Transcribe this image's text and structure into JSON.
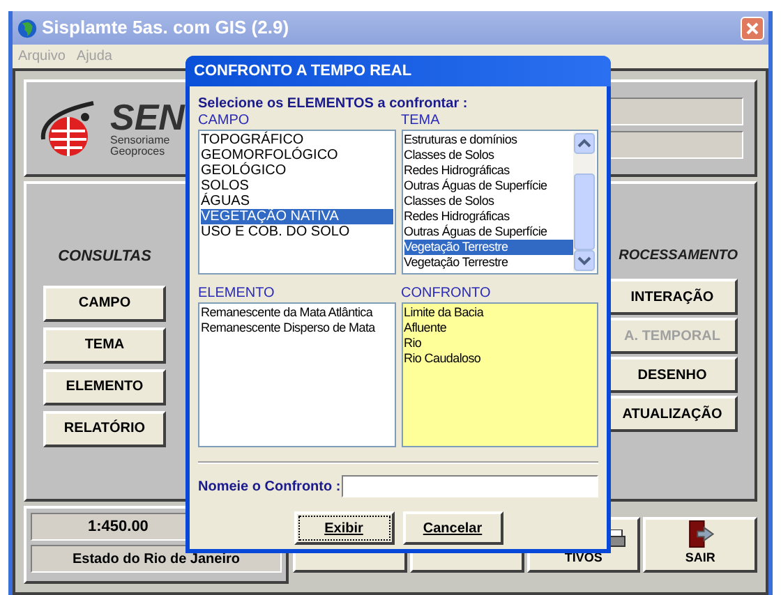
{
  "window": {
    "title": "Sisplamte 5as. com GIS (2.9)"
  },
  "menu": [
    {
      "label": "Arquivo",
      "disabled": true
    },
    {
      "label": "Ajuda",
      "disabled": true
    }
  ],
  "logo": {
    "mark": "SEN",
    "line_1": "Sensoriame",
    "line_2": "Geoproces"
  },
  "consultas": {
    "heading": "CONSULTAS",
    "buttons": [
      {
        "label": "CAMPO",
        "disabled": false
      },
      {
        "label": "TEMA",
        "disabled": false
      },
      {
        "label": "ELEMENTO",
        "disabled": false
      },
      {
        "label": "RELATÓRIO",
        "disabled": false
      }
    ]
  },
  "processamento": {
    "heading": "ROCESSAMENTO",
    "buttons": [
      {
        "label": "INTERAÇÃO",
        "disabled": false
      },
      {
        "label": "A. TEMPORAL",
        "disabled": true
      },
      {
        "label": "DESENHO",
        "disabled": false
      },
      {
        "label": "ATUALIZAÇÃO",
        "disabled": false
      }
    ]
  },
  "status": {
    "scale": "1:450.00",
    "region": "Estado do Rio de Janeiro"
  },
  "bottom_buttons": [
    {
      "kind": "plain"
    },
    {
      "kind": "plain"
    },
    {
      "kind": "printer",
      "label": "TIVOS"
    },
    {
      "kind": "exit",
      "label": "SAIR"
    }
  ],
  "dialog": {
    "title": "CONFRONTO A TEMPO REAL",
    "instruction": "Selecione os ELEMENTOS a confrontar :",
    "campo": {
      "label": "CAMPO",
      "items": [
        {
          "text": "TOPOGRÁFICO",
          "selected": false
        },
        {
          "text": "GEOMORFOLÓGICO",
          "selected": false
        },
        {
          "text": "GEOLÓGICO",
          "selected": false
        },
        {
          "text": "SOLOS",
          "selected": false
        },
        {
          "text": "ÁGUAS",
          "selected": false
        },
        {
          "text": "VEGETAÇÃO NATIVA",
          "selected": true
        },
        {
          "text": "USO E COB. DO SOLO",
          "selected": false
        }
      ]
    },
    "tema": {
      "label": "TEMA",
      "items": [
        {
          "text": "Estruturas e domínios",
          "selected": false
        },
        {
          "text": "Classes de Solos",
          "selected": false
        },
        {
          "text": "Redes Hidrográficas",
          "selected": false
        },
        {
          "text": "Outras Águas de Superfície",
          "selected": false
        },
        {
          "text": "Classes de Solos",
          "selected": false
        },
        {
          "text": "Redes Hidrográficas",
          "selected": false
        },
        {
          "text": "Outras Águas de Superfície",
          "selected": false
        },
        {
          "text": "Vegetação Terrestre",
          "selected": true
        },
        {
          "text": "Vegetação Terrestre",
          "selected": false
        }
      ]
    },
    "elemento": {
      "label": "ELEMENTO",
      "items": [
        {
          "text": "Remanescente da Mata Atlântica",
          "selected": false
        },
        {
          "text": "Remanescente Disperso de Mata",
          "selected": false
        }
      ]
    },
    "confronto": {
      "label": "CONFRONTO",
      "items": [
        {
          "text": "Limite da Bacia",
          "selected": false
        },
        {
          "text": "Afluente",
          "selected": false
        },
        {
          "text": "Rio",
          "selected": false
        },
        {
          "text": "Rio Caudaloso",
          "selected": false
        }
      ]
    },
    "name_label": "Nomeie o Confronto :",
    "buttons": [
      {
        "label": "Exibir",
        "focused": true
      },
      {
        "label": "Cancelar",
        "focused": false
      }
    ]
  }
}
